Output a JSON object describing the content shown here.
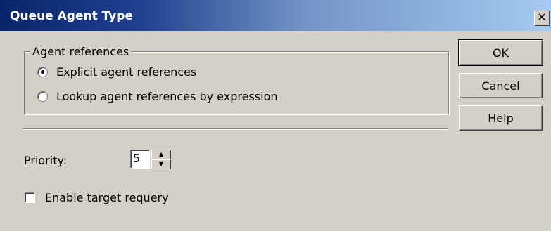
{
  "window": {
    "title": "Queue Agent Type",
    "close_icon": "✕"
  },
  "agent_references": {
    "legend": "Agent references",
    "options": [
      {
        "label": "Explicit agent references",
        "checked": true
      },
      {
        "label": "Lookup agent references by expression",
        "checked": false
      }
    ]
  },
  "buttons": {
    "ok": "OK",
    "cancel": "Cancel",
    "help": "Help"
  },
  "priority": {
    "label": "Priority:",
    "value": "5",
    "up_icon": "▲",
    "down_icon": "▼"
  },
  "requery": {
    "label": "Enable target requery",
    "checked": false
  },
  "colors": {
    "title_bar_start": "#0a246a",
    "title_bar_end": "#a6caf0",
    "dialog_bg": "#d4d0c8"
  }
}
